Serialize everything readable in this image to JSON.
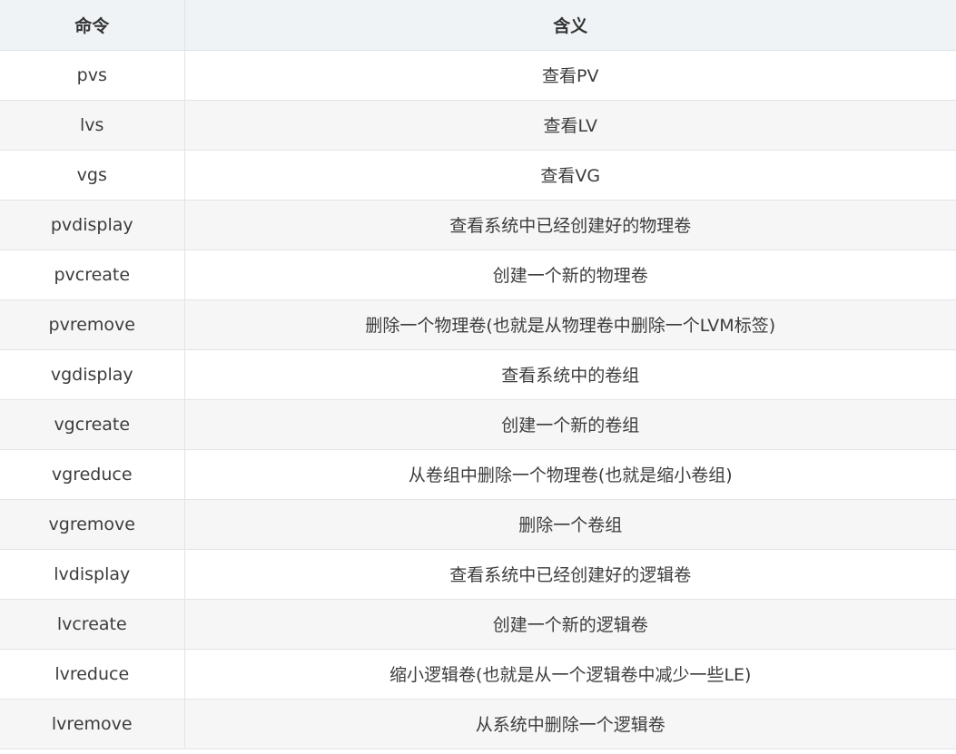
{
  "table": {
    "headers": {
      "command": "命令",
      "meaning": "含义"
    },
    "rows": [
      {
        "command": "pvs",
        "meaning": "查看PV"
      },
      {
        "command": "lvs",
        "meaning": "查看LV"
      },
      {
        "command": "vgs",
        "meaning": "查看VG"
      },
      {
        "command": "pvdisplay",
        "meaning": "查看系统中已经创建好的物理卷"
      },
      {
        "command": "pvcreate",
        "meaning": "创建一个新的物理卷"
      },
      {
        "command": "pvremove",
        "meaning": "删除一个物理卷(也就是从物理卷中删除一个LVM标签)"
      },
      {
        "command": "vgdisplay",
        "meaning": "查看系统中的卷组"
      },
      {
        "command": "vgcreate",
        "meaning": "创建一个新的卷组"
      },
      {
        "command": "vgreduce",
        "meaning": "从卷组中删除一个物理卷(也就是缩小卷组)"
      },
      {
        "command": "vgremove",
        "meaning": "删除一个卷组"
      },
      {
        "command": "lvdisplay",
        "meaning": "查看系统中已经创建好的逻辑卷"
      },
      {
        "command": "lvcreate",
        "meaning": "创建一个新的逻辑卷"
      },
      {
        "command": "lvreduce",
        "meaning": "缩小逻辑卷(也就是从一个逻辑卷中减少一些LE)"
      },
      {
        "command": "lvremove",
        "meaning": "从系统中删除一个逻辑卷"
      }
    ]
  }
}
